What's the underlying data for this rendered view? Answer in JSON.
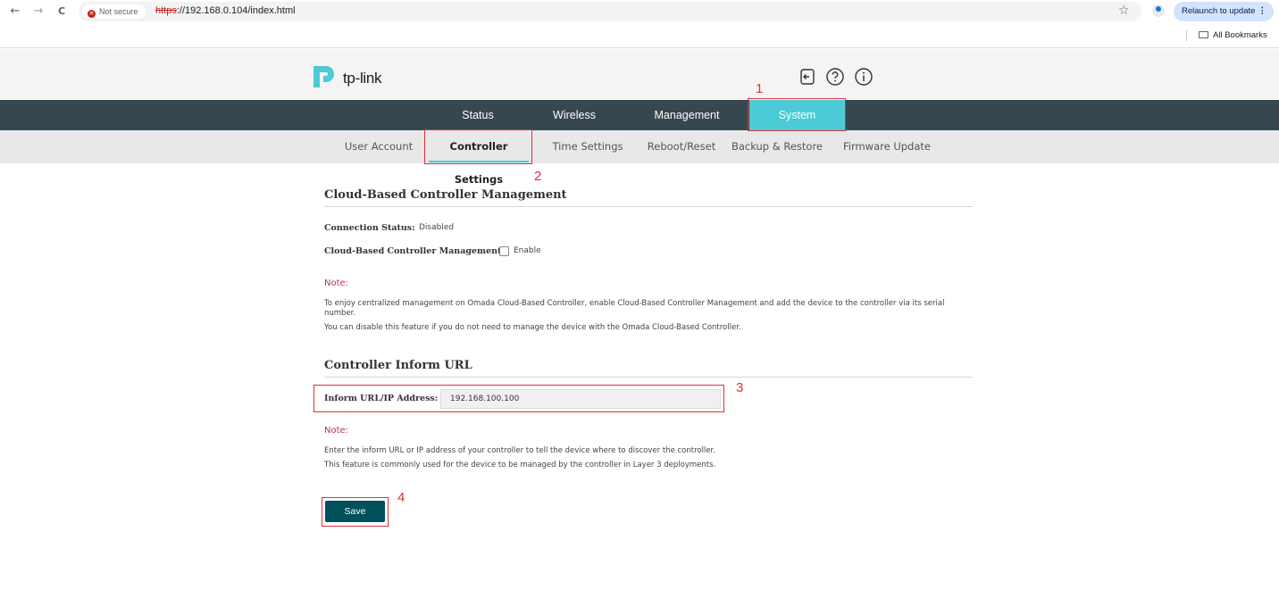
{
  "browser": {
    "back_glyph": "←",
    "forward_glyph": "→",
    "reload_glyph": "C",
    "security_label": "Not secure",
    "url_scheme": "https",
    "url_rest": "://192.168.0.104/index.html",
    "star_glyph": "☆",
    "relaunch_label": "Relaunch to update",
    "relaunch_menu_glyph": "⋮",
    "bookmarks_label": "All Bookmarks"
  },
  "header": {
    "logo_text": "tp-link",
    "icons": [
      "logout-icon",
      "help-icon",
      "info-icon"
    ],
    "accent_color": "#4acbd6",
    "nav_bg_color": "#37474f"
  },
  "main_nav": {
    "tabs": [
      {
        "label": "Status",
        "active": false
      },
      {
        "label": "Wireless",
        "active": false
      },
      {
        "label": "Management",
        "active": false
      },
      {
        "label": "System",
        "active": true
      }
    ]
  },
  "sub_nav": {
    "tabs": [
      {
        "label": "User Account",
        "active": false
      },
      {
        "label": "Controller Settings",
        "active": true
      },
      {
        "label": "Time Settings",
        "active": false
      },
      {
        "label": "Reboot/Reset",
        "active": false
      },
      {
        "label": "Backup & Restore",
        "active": false
      },
      {
        "label": "Firmware Update",
        "active": false
      }
    ]
  },
  "cloud_section": {
    "title": "Cloud-Based Controller Management",
    "connection_status_label": "Connection Status:",
    "connection_status_value": "Disabled",
    "management_label": "Cloud-Based Controller Management:",
    "enable_label": "Enable",
    "enable_checked": false,
    "note_label": "Note:",
    "note_line1": "To enjoy centralized management on Omada Cloud-Based Controller, enable Cloud-Based Controller Management and add the device to the controller via its serial number.",
    "note_line2": "You can disable this feature if you do not need to manage the device with the Omada Cloud-Based Controller."
  },
  "inform_section": {
    "title": "Controller Inform URL",
    "field_label": "Inform URL/IP Address:",
    "field_value": "192.168.100.100",
    "note_label": "Note:",
    "note_line1": "Enter the inform URL or IP address of your controller to tell the device where to discover the controller.",
    "note_line2": "This feature is commonly used for the device to be managed by the controller in Layer 3 deployments."
  },
  "actions": {
    "save_label": "Save"
  },
  "annotations": {
    "step1": "1",
    "step2": "2",
    "step3": "3",
    "step4": "4",
    "color": "#e0303b"
  }
}
